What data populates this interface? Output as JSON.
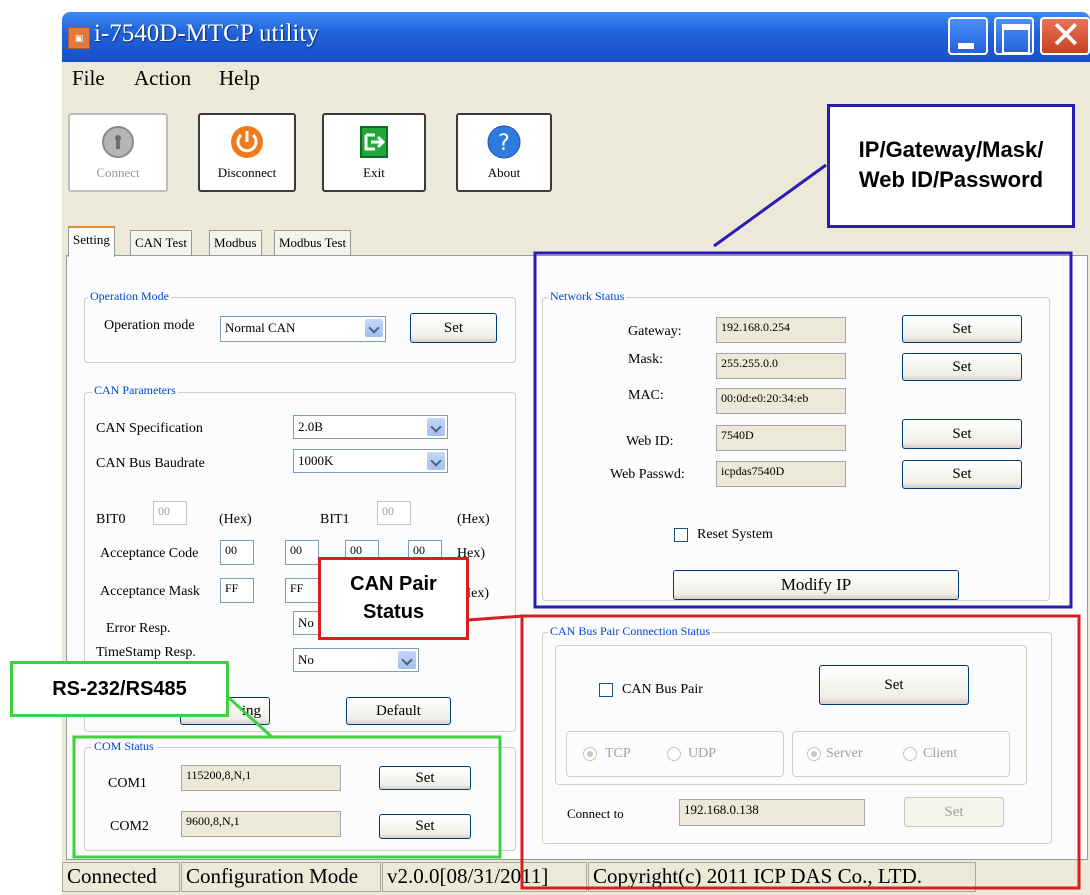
{
  "window": {
    "title": "i-7540D-MTCP utility",
    "icon": "app-icon"
  },
  "menu": [
    "File",
    "Action",
    "Help"
  ],
  "toolbar": {
    "connect": "Connect",
    "disconnect": "Disconnect",
    "exit": "Exit",
    "about": "About"
  },
  "tabs": [
    "Setting",
    "CAN Test",
    "Modbus",
    "Modbus Test"
  ],
  "operation_mode": {
    "group": "Operation Mode",
    "label": "Operation mode",
    "value": "Normal CAN",
    "set": "Set"
  },
  "can_params": {
    "group": "CAN Parameters",
    "spec_label": "CAN Specification",
    "spec_value": "2.0B",
    "baud_label": "CAN Bus Baudrate",
    "baud_value": "1000K",
    "bit0_label": "BIT0",
    "bit0_value": "00",
    "bit1_label": "BIT1",
    "bit1_value": "00",
    "hex": "(Hex)",
    "hex_partial": "(Hex)",
    "hex_partial2": "Hex)",
    "hex_partial3": "Hex)",
    "acc_code_label": "Acceptance Code",
    "acc_code": [
      "00",
      "00",
      "00",
      "00"
    ],
    "acc_mask_label": "Acceptance Mask",
    "acc_mask": [
      "FF",
      "FF"
    ],
    "err_label": "Error Resp.",
    "err_value": "No",
    "ts_label": "TimeStamp Resp.",
    "ts_value": "No",
    "setting_btn_partial": "ing",
    "default_btn": "Default"
  },
  "com_status": {
    "group": "COM Status",
    "com1_label": "COM1",
    "com1_value": "115200,8,N,1",
    "com2_label": "COM2",
    "com2_value": "9600,8,N,1",
    "set": "Set"
  },
  "network": {
    "group": "Network Status",
    "gateway_label": "Gateway:",
    "gateway": "192.168.0.254",
    "mask_label": "Mask:",
    "mask": "255.255.0.0",
    "mac_label": "MAC:",
    "mac": "00:0d:e0:20:34:eb",
    "webid_label": "Web ID:",
    "webid": "7540D",
    "webpw_label": "Web Passwd:",
    "webpw": "icpdas7540D",
    "set": "Set",
    "reset_label": "Reset System",
    "modify_ip": "Modify IP"
  },
  "can_pair": {
    "group": "CAN Bus Pair Connection Status",
    "pair_label": "CAN Bus Pair",
    "set": "Set",
    "tcp": "TCP",
    "udp": "UDP",
    "server": "Server",
    "client": "Client",
    "connect_label": "Connect to",
    "connect_value": "192.168.0.138"
  },
  "statusbar": [
    "Connected",
    "Configuration Mode",
    "v2.0.0[08/31/2011]",
    "Copyright(c) 2011 ICP DAS Co., LTD."
  ],
  "callouts": {
    "ip": [
      "IP/Gateway/Mask/",
      "Web ID/Password"
    ],
    "can": [
      "CAN Pair",
      "Status"
    ],
    "rs": "RS-232/RS485"
  },
  "colors": {
    "ip_callout": "#2b1bb5",
    "can_callout": "#d91e1e",
    "rs_callout": "#3fd13f",
    "titlebar": "#1f5fd8"
  }
}
